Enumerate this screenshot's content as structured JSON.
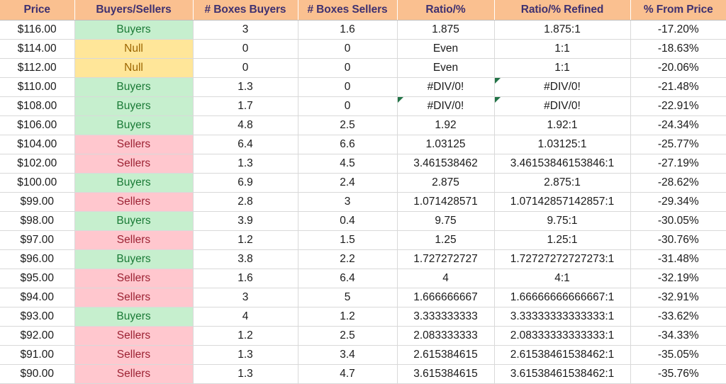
{
  "table": {
    "columns": [
      {
        "key": "price",
        "label": "Price"
      },
      {
        "key": "status",
        "label": "Buyers/Sellers"
      },
      {
        "key": "boxes_buyers",
        "label": "# Boxes Buyers"
      },
      {
        "key": "boxes_sellers",
        "label": "# Boxes Sellers"
      },
      {
        "key": "ratio",
        "label": "Ratio/%"
      },
      {
        "key": "refined",
        "label": "Ratio/% Refined"
      },
      {
        "key": "pct",
        "label": "% From Price"
      }
    ],
    "colors": {
      "header_bg": "#FAC090",
      "header_text": "#3F3170",
      "buyers_bg": "#C6EFCE",
      "buyers_text": "#1A7A36",
      "sellers_bg": "#FFC7CE",
      "sellers_text": "#9C2233",
      "null_bg": "#FFE699",
      "null_text": "#9C6500",
      "grid": "#D9D9D9",
      "error_marker": "#217346"
    },
    "rows": [
      {
        "price": "$116.00",
        "status": "Buyers",
        "boxes_buyers": "3",
        "boxes_sellers": "1.6",
        "ratio": "1.875",
        "refined": "1.875:1",
        "pct": "-17.20%",
        "ratio_error": false,
        "refined_error": false
      },
      {
        "price": "$114.00",
        "status": "Null",
        "boxes_buyers": "0",
        "boxes_sellers": "0",
        "ratio": "Even",
        "refined": "1:1",
        "pct": "-18.63%",
        "ratio_error": false,
        "refined_error": false
      },
      {
        "price": "$112.00",
        "status": "Null",
        "boxes_buyers": "0",
        "boxes_sellers": "0",
        "ratio": "Even",
        "refined": "1:1",
        "pct": "-20.06%",
        "ratio_error": false,
        "refined_error": false
      },
      {
        "price": "$110.00",
        "status": "Buyers",
        "boxes_buyers": "1.3",
        "boxes_sellers": "0",
        "ratio": "#DIV/0!",
        "refined": "#DIV/0!",
        "pct": "-21.48%",
        "ratio_error": false,
        "refined_error": true
      },
      {
        "price": "$108.00",
        "status": "Buyers",
        "boxes_buyers": "1.7",
        "boxes_sellers": "0",
        "ratio": "#DIV/0!",
        "refined": "#DIV/0!",
        "pct": "-22.91%",
        "ratio_error": true,
        "refined_error": true
      },
      {
        "price": "$106.00",
        "status": "Buyers",
        "boxes_buyers": "4.8",
        "boxes_sellers": "2.5",
        "ratio": "1.92",
        "refined": "1.92:1",
        "pct": "-24.34%",
        "ratio_error": false,
        "refined_error": false
      },
      {
        "price": "$104.00",
        "status": "Sellers",
        "boxes_buyers": "6.4",
        "boxes_sellers": "6.6",
        "ratio": "1.03125",
        "refined": "1.03125:1",
        "pct": "-25.77%",
        "ratio_error": false,
        "refined_error": false
      },
      {
        "price": "$102.00",
        "status": "Sellers",
        "boxes_buyers": "1.3",
        "boxes_sellers": "4.5",
        "ratio": "3.461538462",
        "refined": "3.46153846153846:1",
        "pct": "-27.19%",
        "ratio_error": false,
        "refined_error": false
      },
      {
        "price": "$100.00",
        "status": "Buyers",
        "boxes_buyers": "6.9",
        "boxes_sellers": "2.4",
        "ratio": "2.875",
        "refined": "2.875:1",
        "pct": "-28.62%",
        "ratio_error": false,
        "refined_error": false
      },
      {
        "price": "$99.00",
        "status": "Sellers",
        "boxes_buyers": "2.8",
        "boxes_sellers": "3",
        "ratio": "1.071428571",
        "refined": "1.07142857142857:1",
        "pct": "-29.34%",
        "ratio_error": false,
        "refined_error": false
      },
      {
        "price": "$98.00",
        "status": "Buyers",
        "boxes_buyers": "3.9",
        "boxes_sellers": "0.4",
        "ratio": "9.75",
        "refined": "9.75:1",
        "pct": "-30.05%",
        "ratio_error": false,
        "refined_error": false
      },
      {
        "price": "$97.00",
        "status": "Sellers",
        "boxes_buyers": "1.2",
        "boxes_sellers": "1.5",
        "ratio": "1.25",
        "refined": "1.25:1",
        "pct": "-30.76%",
        "ratio_error": false,
        "refined_error": false
      },
      {
        "price": "$96.00",
        "status": "Buyers",
        "boxes_buyers": "3.8",
        "boxes_sellers": "2.2",
        "ratio": "1.727272727",
        "refined": "1.72727272727273:1",
        "pct": "-31.48%",
        "ratio_error": false,
        "refined_error": false
      },
      {
        "price": "$95.00",
        "status": "Sellers",
        "boxes_buyers": "1.6",
        "boxes_sellers": "6.4",
        "ratio": "4",
        "refined": "4:1",
        "pct": "-32.19%",
        "ratio_error": false,
        "refined_error": false
      },
      {
        "price": "$94.00",
        "status": "Sellers",
        "boxes_buyers": "3",
        "boxes_sellers": "5",
        "ratio": "1.666666667",
        "refined": "1.66666666666667:1",
        "pct": "-32.91%",
        "ratio_error": false,
        "refined_error": false
      },
      {
        "price": "$93.00",
        "status": "Buyers",
        "boxes_buyers": "4",
        "boxes_sellers": "1.2",
        "ratio": "3.333333333",
        "refined": "3.33333333333333:1",
        "pct": "-33.62%",
        "ratio_error": false,
        "refined_error": false
      },
      {
        "price": "$92.00",
        "status": "Sellers",
        "boxes_buyers": "1.2",
        "boxes_sellers": "2.5",
        "ratio": "2.083333333",
        "refined": "2.08333333333333:1",
        "pct": "-34.33%",
        "ratio_error": false,
        "refined_error": false
      },
      {
        "price": "$91.00",
        "status": "Sellers",
        "boxes_buyers": "1.3",
        "boxes_sellers": "3.4",
        "ratio": "2.615384615",
        "refined": "2.61538461538462:1",
        "pct": "-35.05%",
        "ratio_error": false,
        "refined_error": false
      },
      {
        "price": "$90.00",
        "status": "Sellers",
        "boxes_buyers": "1.3",
        "boxes_sellers": "4.7",
        "ratio": "3.615384615",
        "refined": "3.61538461538462:1",
        "pct": "-35.76%",
        "ratio_error": false,
        "refined_error": false
      }
    ]
  }
}
